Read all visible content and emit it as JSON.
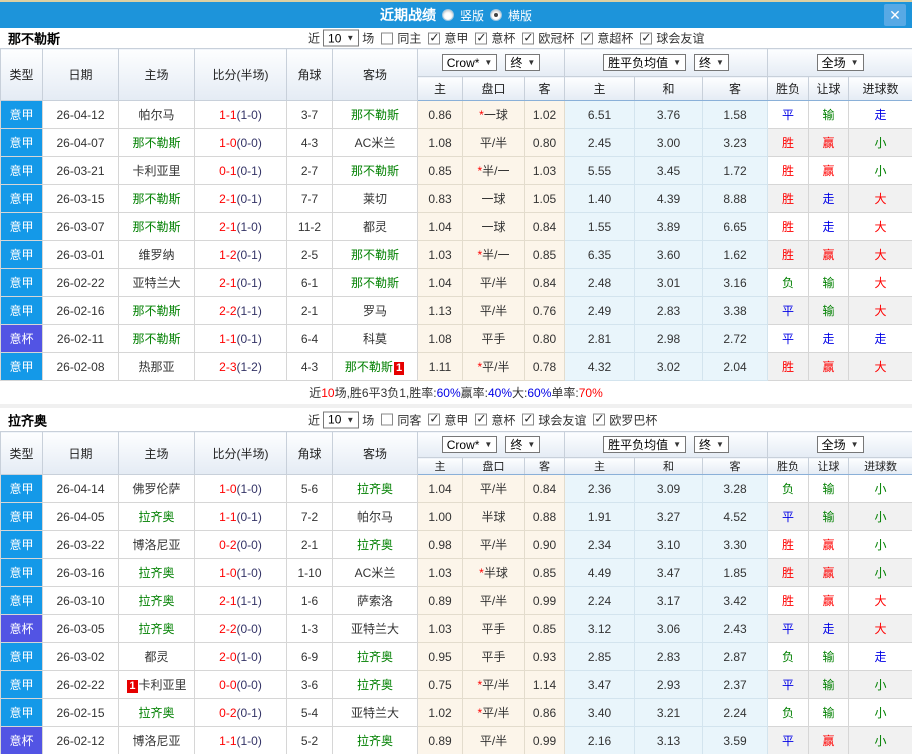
{
  "titlebar": {
    "title": "近期战绩",
    "vertical_label": "竖版",
    "horizontal_label": "横版",
    "selected": "横版",
    "close_glyph": "✕"
  },
  "filters": {
    "near": "近",
    "count": "10",
    "games": "场"
  },
  "header": {
    "static_cols": [
      "类型",
      "日期",
      "主场",
      "比分(半场)",
      "角球",
      "客场"
    ],
    "bookmaker_select": "Crow*",
    "final_select": "终",
    "odds_cols": [
      "主",
      "盘口",
      "客"
    ],
    "wdl_select": "胜平负均值",
    "wdl_final_select": "终",
    "wdl_cols": [
      "主",
      "和",
      "客"
    ],
    "scope_select": "全场",
    "result_cols": [
      "胜负",
      "让球",
      "进球数"
    ]
  },
  "colors": {
    "accent": "#1d94da",
    "league": {
      "意甲": "#1499e8",
      "意杯": "#5254e4"
    },
    "result_red": "#ff0000",
    "result_blue": "#0000e6",
    "result_green": "#008000",
    "score_red": "#ff0000",
    "half_navy": "#333366",
    "team_green": "#008000"
  },
  "sections": [
    {
      "team": "那不勒斯",
      "same_side": "同主",
      "same_checked": false,
      "leagues": [
        "意甲",
        "意杯",
        "欧冠杯",
        "意超杯",
        "球会友谊"
      ],
      "rows": [
        {
          "type": "意甲",
          "date": "26-04-12",
          "home": "帕尔马",
          "home_badge": "",
          "score": "1-1",
          "half": "(1-0)",
          "corner": "3-7",
          "away": "那不勒斯",
          "away_badge": "",
          "hl_side": "a",
          "odds_home": "0.86",
          "handicap": "*一球",
          "odds_away": "1.02",
          "win": "6.51",
          "draw": "3.76",
          "lose": "1.58",
          "results": [
            "平",
            "输",
            "走"
          ]
        },
        {
          "type": "意甲",
          "date": "26-04-07",
          "home": "那不勒斯",
          "home_badge": "",
          "score": "1-0",
          "half": "(0-0)",
          "corner": "4-3",
          "away": "AC米兰",
          "away_badge": "",
          "hl_side": "h",
          "odds_home": "1.08",
          "handicap": "平/半",
          "odds_away": "0.80",
          "win": "2.45",
          "draw": "3.00",
          "lose": "3.23",
          "results": [
            "胜",
            "赢",
            "小"
          ]
        },
        {
          "type": "意甲",
          "date": "26-03-21",
          "home": "卡利亚里",
          "home_badge": "",
          "score": "0-1",
          "half": "(0-1)",
          "corner": "2-7",
          "away": "那不勒斯",
          "away_badge": "",
          "hl_side": "a",
          "odds_home": "0.85",
          "handicap": "*半/一",
          "odds_away": "1.03",
          "win": "5.55",
          "draw": "3.45",
          "lose": "1.72",
          "results": [
            "胜",
            "赢",
            "小"
          ]
        },
        {
          "type": "意甲",
          "date": "26-03-15",
          "home": "那不勒斯",
          "home_badge": "",
          "score": "2-1",
          "half": "(0-1)",
          "corner": "7-7",
          "away": "莱切",
          "away_badge": "",
          "hl_side": "h",
          "odds_home": "0.83",
          "handicap": "一球",
          "odds_away": "1.05",
          "win": "1.40",
          "draw": "4.39",
          "lose": "8.88",
          "results": [
            "胜",
            "走",
            "大"
          ]
        },
        {
          "type": "意甲",
          "date": "26-03-07",
          "home": "那不勒斯",
          "home_badge": "",
          "score": "2-1",
          "half": "(1-0)",
          "corner": "11-2",
          "away": "都灵",
          "away_badge": "",
          "hl_side": "h",
          "odds_home": "1.04",
          "handicap": "一球",
          "odds_away": "0.84",
          "win": "1.55",
          "draw": "3.89",
          "lose": "6.65",
          "results": [
            "胜",
            "走",
            "大"
          ]
        },
        {
          "type": "意甲",
          "date": "26-03-01",
          "home": "维罗纳",
          "home_badge": "",
          "score": "1-2",
          "half": "(0-1)",
          "corner": "2-5",
          "away": "那不勒斯",
          "away_badge": "",
          "hl_side": "a",
          "odds_home": "1.03",
          "handicap": "*半/一",
          "odds_away": "0.85",
          "win": "6.35",
          "draw": "3.60",
          "lose": "1.62",
          "results": [
            "胜",
            "赢",
            "大"
          ]
        },
        {
          "type": "意甲",
          "date": "26-02-22",
          "home": "亚特兰大",
          "home_badge": "",
          "score": "2-1",
          "half": "(0-1)",
          "corner": "6-1",
          "away": "那不勒斯",
          "away_badge": "",
          "hl_side": "a",
          "odds_home": "1.04",
          "handicap": "平/半",
          "odds_away": "0.84",
          "win": "2.48",
          "draw": "3.01",
          "lose": "3.16",
          "results": [
            "负",
            "输",
            "大"
          ]
        },
        {
          "type": "意甲",
          "date": "26-02-16",
          "home": "那不勒斯",
          "home_badge": "",
          "score": "2-2",
          "half": "(1-1)",
          "corner": "2-1",
          "away": "罗马",
          "away_badge": "",
          "hl_side": "h",
          "odds_home": "1.13",
          "handicap": "平/半",
          "odds_away": "0.76",
          "win": "2.49",
          "draw": "2.83",
          "lose": "3.38",
          "results": [
            "平",
            "输",
            "大"
          ]
        },
        {
          "type": "意杯",
          "date": "26-02-11",
          "home": "那不勒斯",
          "home_badge": "",
          "score": "1-1",
          "half": "(0-1)",
          "corner": "6-4",
          "away": "科莫",
          "away_badge": "",
          "hl_side": "h",
          "odds_home": "1.08",
          "handicap": "平手",
          "odds_away": "0.80",
          "win": "2.81",
          "draw": "2.98",
          "lose": "2.72",
          "results": [
            "平",
            "走",
            "走"
          ]
        },
        {
          "type": "意甲",
          "date": "26-02-08",
          "home": "热那亚",
          "home_badge": "",
          "score": "2-3",
          "half": "(1-2)",
          "corner": "4-3",
          "away": "那不勒斯",
          "away_badge": "1",
          "hl_side": "a",
          "odds_home": "1.11",
          "handicap": "*平/半",
          "odds_away": "0.78",
          "win": "4.32",
          "draw": "3.02",
          "lose": "2.04",
          "results": [
            "胜",
            "赢",
            "大"
          ]
        }
      ],
      "summary": [
        {
          "text": "近",
          "color": "k"
        },
        {
          "text": "10",
          "color": "r"
        },
        {
          "text": "场,胜6平3负1, ",
          "color": "k"
        },
        {
          "text": "胜率:",
          "color": "k"
        },
        {
          "text": "60%",
          "color": "b"
        },
        {
          "text": " 赢率:",
          "color": "k"
        },
        {
          "text": "40%",
          "color": "b"
        },
        {
          "text": " 大:",
          "color": "k"
        },
        {
          "text": "60%",
          "color": "b"
        },
        {
          "text": " 单率:",
          "color": "k"
        },
        {
          "text": "70%",
          "color": "r"
        }
      ]
    },
    {
      "team": "拉齐奥",
      "same_side": "同客",
      "same_checked": false,
      "leagues": [
        "意甲",
        "意杯",
        "球会友谊",
        "欧罗巴杯"
      ],
      "rows": [
        {
          "type": "意甲",
          "date": "26-04-14",
          "home": "佛罗伦萨",
          "home_badge": "",
          "score": "1-0",
          "half": "(1-0)",
          "corner": "5-6",
          "away": "拉齐奥",
          "away_badge": "",
          "hl_side": "a",
          "odds_home": "1.04",
          "handicap": "平/半",
          "odds_away": "0.84",
          "win": "2.36",
          "draw": "3.09",
          "lose": "3.28",
          "results": [
            "负",
            "输",
            "小"
          ]
        },
        {
          "type": "意甲",
          "date": "26-04-05",
          "home": "拉齐奥",
          "home_badge": "",
          "score": "1-1",
          "half": "(0-1)",
          "corner": "7-2",
          "away": "帕尔马",
          "away_badge": "",
          "hl_side": "h",
          "odds_home": "1.00",
          "handicap": "半球",
          "odds_away": "0.88",
          "win": "1.91",
          "draw": "3.27",
          "lose": "4.52",
          "results": [
            "平",
            "输",
            "小"
          ]
        },
        {
          "type": "意甲",
          "date": "26-03-22",
          "home": "博洛尼亚",
          "home_badge": "",
          "score": "0-2",
          "half": "(0-0)",
          "corner": "2-1",
          "away": "拉齐奥",
          "away_badge": "",
          "hl_side": "a",
          "odds_home": "0.98",
          "handicap": "平/半",
          "odds_away": "0.90",
          "win": "2.34",
          "draw": "3.10",
          "lose": "3.30",
          "results": [
            "胜",
            "赢",
            "小"
          ]
        },
        {
          "type": "意甲",
          "date": "26-03-16",
          "home": "拉齐奥",
          "home_badge": "",
          "score": "1-0",
          "half": "(1-0)",
          "corner": "1-10",
          "away": "AC米兰",
          "away_badge": "",
          "hl_side": "h",
          "odds_home": "1.03",
          "handicap": "*半球",
          "odds_away": "0.85",
          "win": "4.49",
          "draw": "3.47",
          "lose": "1.85",
          "results": [
            "胜",
            "赢",
            "小"
          ]
        },
        {
          "type": "意甲",
          "date": "26-03-10",
          "home": "拉齐奥",
          "home_badge": "",
          "score": "2-1",
          "half": "(1-1)",
          "corner": "1-6",
          "away": "萨索洛",
          "away_badge": "",
          "hl_side": "h",
          "odds_home": "0.89",
          "handicap": "平/半",
          "odds_away": "0.99",
          "win": "2.24",
          "draw": "3.17",
          "lose": "3.42",
          "results": [
            "胜",
            "赢",
            "大"
          ]
        },
        {
          "type": "意杯",
          "date": "26-03-05",
          "home": "拉齐奥",
          "home_badge": "",
          "score": "2-2",
          "half": "(0-0)",
          "corner": "1-3",
          "away": "亚特兰大",
          "away_badge": "",
          "hl_side": "h",
          "odds_home": "1.03",
          "handicap": "平手",
          "odds_away": "0.85",
          "win": "3.12",
          "draw": "3.06",
          "lose": "2.43",
          "results": [
            "平",
            "走",
            "大"
          ]
        },
        {
          "type": "意甲",
          "date": "26-03-02",
          "home": "都灵",
          "home_badge": "",
          "score": "2-0",
          "half": "(1-0)",
          "corner": "6-9",
          "away": "拉齐奥",
          "away_badge": "",
          "hl_side": "a",
          "odds_home": "0.95",
          "handicap": "平手",
          "odds_away": "0.93",
          "win": "2.85",
          "draw": "2.83",
          "lose": "2.87",
          "results": [
            "负",
            "输",
            "走"
          ]
        },
        {
          "type": "意甲",
          "date": "26-02-22",
          "home": "卡利亚里",
          "home_badge": "1",
          "score": "0-0",
          "half": "(0-0)",
          "corner": "3-6",
          "away": "拉齐奥",
          "away_badge": "",
          "hl_side": "a",
          "odds_home": "0.75",
          "handicap": "*平/半",
          "odds_away": "1.14",
          "win": "3.47",
          "draw": "2.93",
          "lose": "2.37",
          "results": [
            "平",
            "输",
            "小"
          ]
        },
        {
          "type": "意甲",
          "date": "26-02-15",
          "home": "拉齐奥",
          "home_badge": "",
          "score": "0-2",
          "half": "(0-1)",
          "corner": "5-4",
          "away": "亚特兰大",
          "away_badge": "",
          "hl_side": "h",
          "odds_home": "1.02",
          "handicap": "*平/半",
          "odds_away": "0.86",
          "win": "3.40",
          "draw": "3.21",
          "lose": "2.24",
          "results": [
            "负",
            "输",
            "小"
          ]
        },
        {
          "type": "意杯",
          "date": "26-02-12",
          "home": "博洛尼亚",
          "home_badge": "",
          "score": "1-1",
          "half": "(1-0)",
          "corner": "5-2",
          "away": "拉齐奥",
          "away_badge": "",
          "hl_side": "a",
          "odds_home": "0.89",
          "handicap": "平/半",
          "odds_away": "0.99",
          "win": "2.16",
          "draw": "3.13",
          "lose": "3.59",
          "results": [
            "平",
            "赢",
            "小"
          ]
        }
      ],
      "summary": null
    }
  ]
}
